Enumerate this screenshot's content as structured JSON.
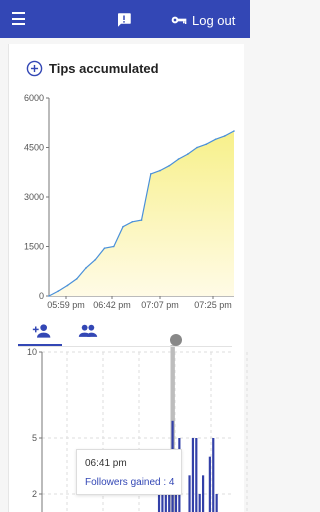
{
  "topbar": {
    "menu_icon": "menu-icon",
    "feedback_icon": "feedback-icon",
    "logout_icon": "key-icon",
    "logout_label": "Log out",
    "color": "#3347b5"
  },
  "tips_card": {
    "icon": "add-circle-icon",
    "title": "Tips accumulated"
  },
  "tabs": [
    {
      "icon": "person-add-icon",
      "active": true
    },
    {
      "icon": "people-icon",
      "active": false
    }
  ],
  "tooltip": {
    "time": "06:41 pm",
    "label": "Followers gained : 4"
  },
  "chart_data": [
    {
      "type": "area",
      "x_tick_labels": [
        "05:59 pm",
        "06:42 pm",
        "07:07 pm",
        "07:25 pm"
      ],
      "y_tick_labels": [
        "0",
        "1500",
        "3000",
        "4500",
        "6000"
      ],
      "ylim": [
        0,
        6000
      ],
      "x": [
        "05:59 pm",
        "06:03 pm",
        "06:08 pm",
        "06:13 pm",
        "06:18 pm",
        "06:22 pm",
        "06:26 pm",
        "06:30 pm",
        "06:33 pm",
        "06:35 pm",
        "06:37 pm",
        "06:41 pm",
        "06:42 pm",
        "06:50 pm",
        "07:00 pm",
        "07:07 pm",
        "07:10 pm",
        "07:15 pm",
        "07:20 pm",
        "07:25 pm",
        "07:35 pm"
      ],
      "values": [
        0,
        150,
        320,
        520,
        850,
        1100,
        1450,
        1500,
        2100,
        2250,
        2300,
        3700,
        3800,
        3950,
        4150,
        4300,
        4500,
        4600,
        4750,
        4850,
        5000
      ],
      "colors": {
        "line": "#4a90d9",
        "fill_top": "#f7f08a",
        "fill_bottom": "#fffbe6"
      }
    },
    {
      "type": "bar",
      "y_tick_labels": [
        "2",
        "5",
        "10"
      ],
      "ylim_visible": [
        1,
        10
      ],
      "values": [
        1,
        1,
        1,
        1,
        1,
        1,
        1,
        1,
        1,
        1,
        1,
        1,
        1,
        1,
        2,
        3,
        4,
        2,
        6,
        2,
        5,
        1,
        1,
        3,
        5,
        5,
        2,
        3,
        1,
        4,
        5,
        2,
        1,
        1,
        1,
        1
      ],
      "highlight_index": 18,
      "colors": {
        "bar": "#3340a8",
        "highlight": "#bdbdbd"
      }
    }
  ]
}
